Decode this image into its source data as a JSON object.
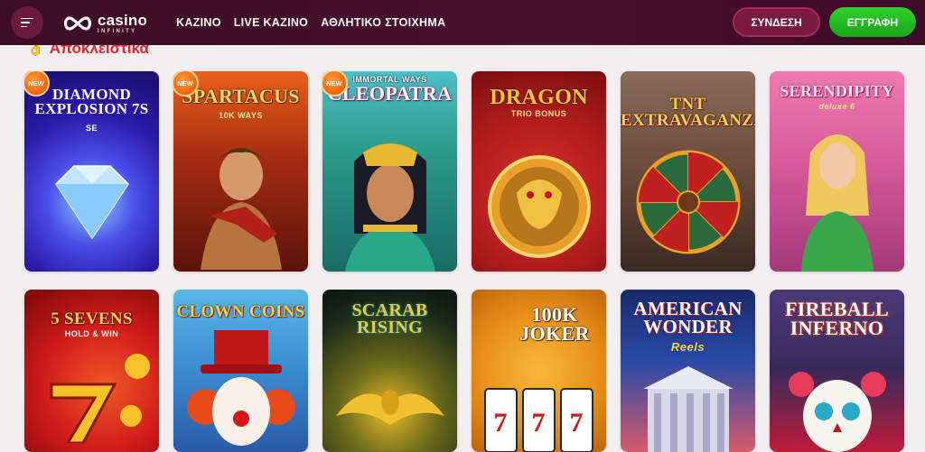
{
  "header": {
    "logo": {
      "word": "casino",
      "sub": "INFINITY"
    },
    "nav": [
      "ΚΑΖΙΝΟ",
      "LIVE ΚΑΖΙΝΟ",
      "ΑΘΛΗΤΙΚΟ ΣΤΟΙΧΗΜΑ"
    ],
    "login_label": "ΣΥΝΔΕΣΗ",
    "register_label": "ΕΓΓΡΑΦΗ"
  },
  "section": {
    "title": "Αποκλειστικά",
    "icon": "hand-icon"
  },
  "badge_label": "NEW",
  "games_row1": [
    {
      "title": "Diamond Explosion 7s",
      "sub": "SE",
      "new": true
    },
    {
      "title": "Spartacus",
      "sub": "10K WAYS",
      "new": true
    },
    {
      "title": "Cleopatra",
      "sub": "IMMORTAL WAYS",
      "new": true
    },
    {
      "title": "Dragon",
      "sub": "TRIO BONUS",
      "new": false
    },
    {
      "title": "TNT Extravaganza",
      "sub": "",
      "new": false
    },
    {
      "title": "Serendipity",
      "sub": "deluxe 6",
      "new": false
    }
  ],
  "games_row2": [
    {
      "title": "5 Sevens",
      "sub": "HOLD & WIN"
    },
    {
      "title": "Clown Coins",
      "sub": ""
    },
    {
      "title": "Scarab Rising",
      "sub": ""
    },
    {
      "title": "100K Joker",
      "sub": ""
    },
    {
      "title": "American Wonder",
      "sub": "Reels"
    },
    {
      "title": "Fireball Inferno",
      "sub": ""
    }
  ],
  "colors": {
    "header_bg": "#3c0d24",
    "accent_red": "#e3262e",
    "register_green": "#1fb51e",
    "login_maroon": "#7a1a3d"
  }
}
